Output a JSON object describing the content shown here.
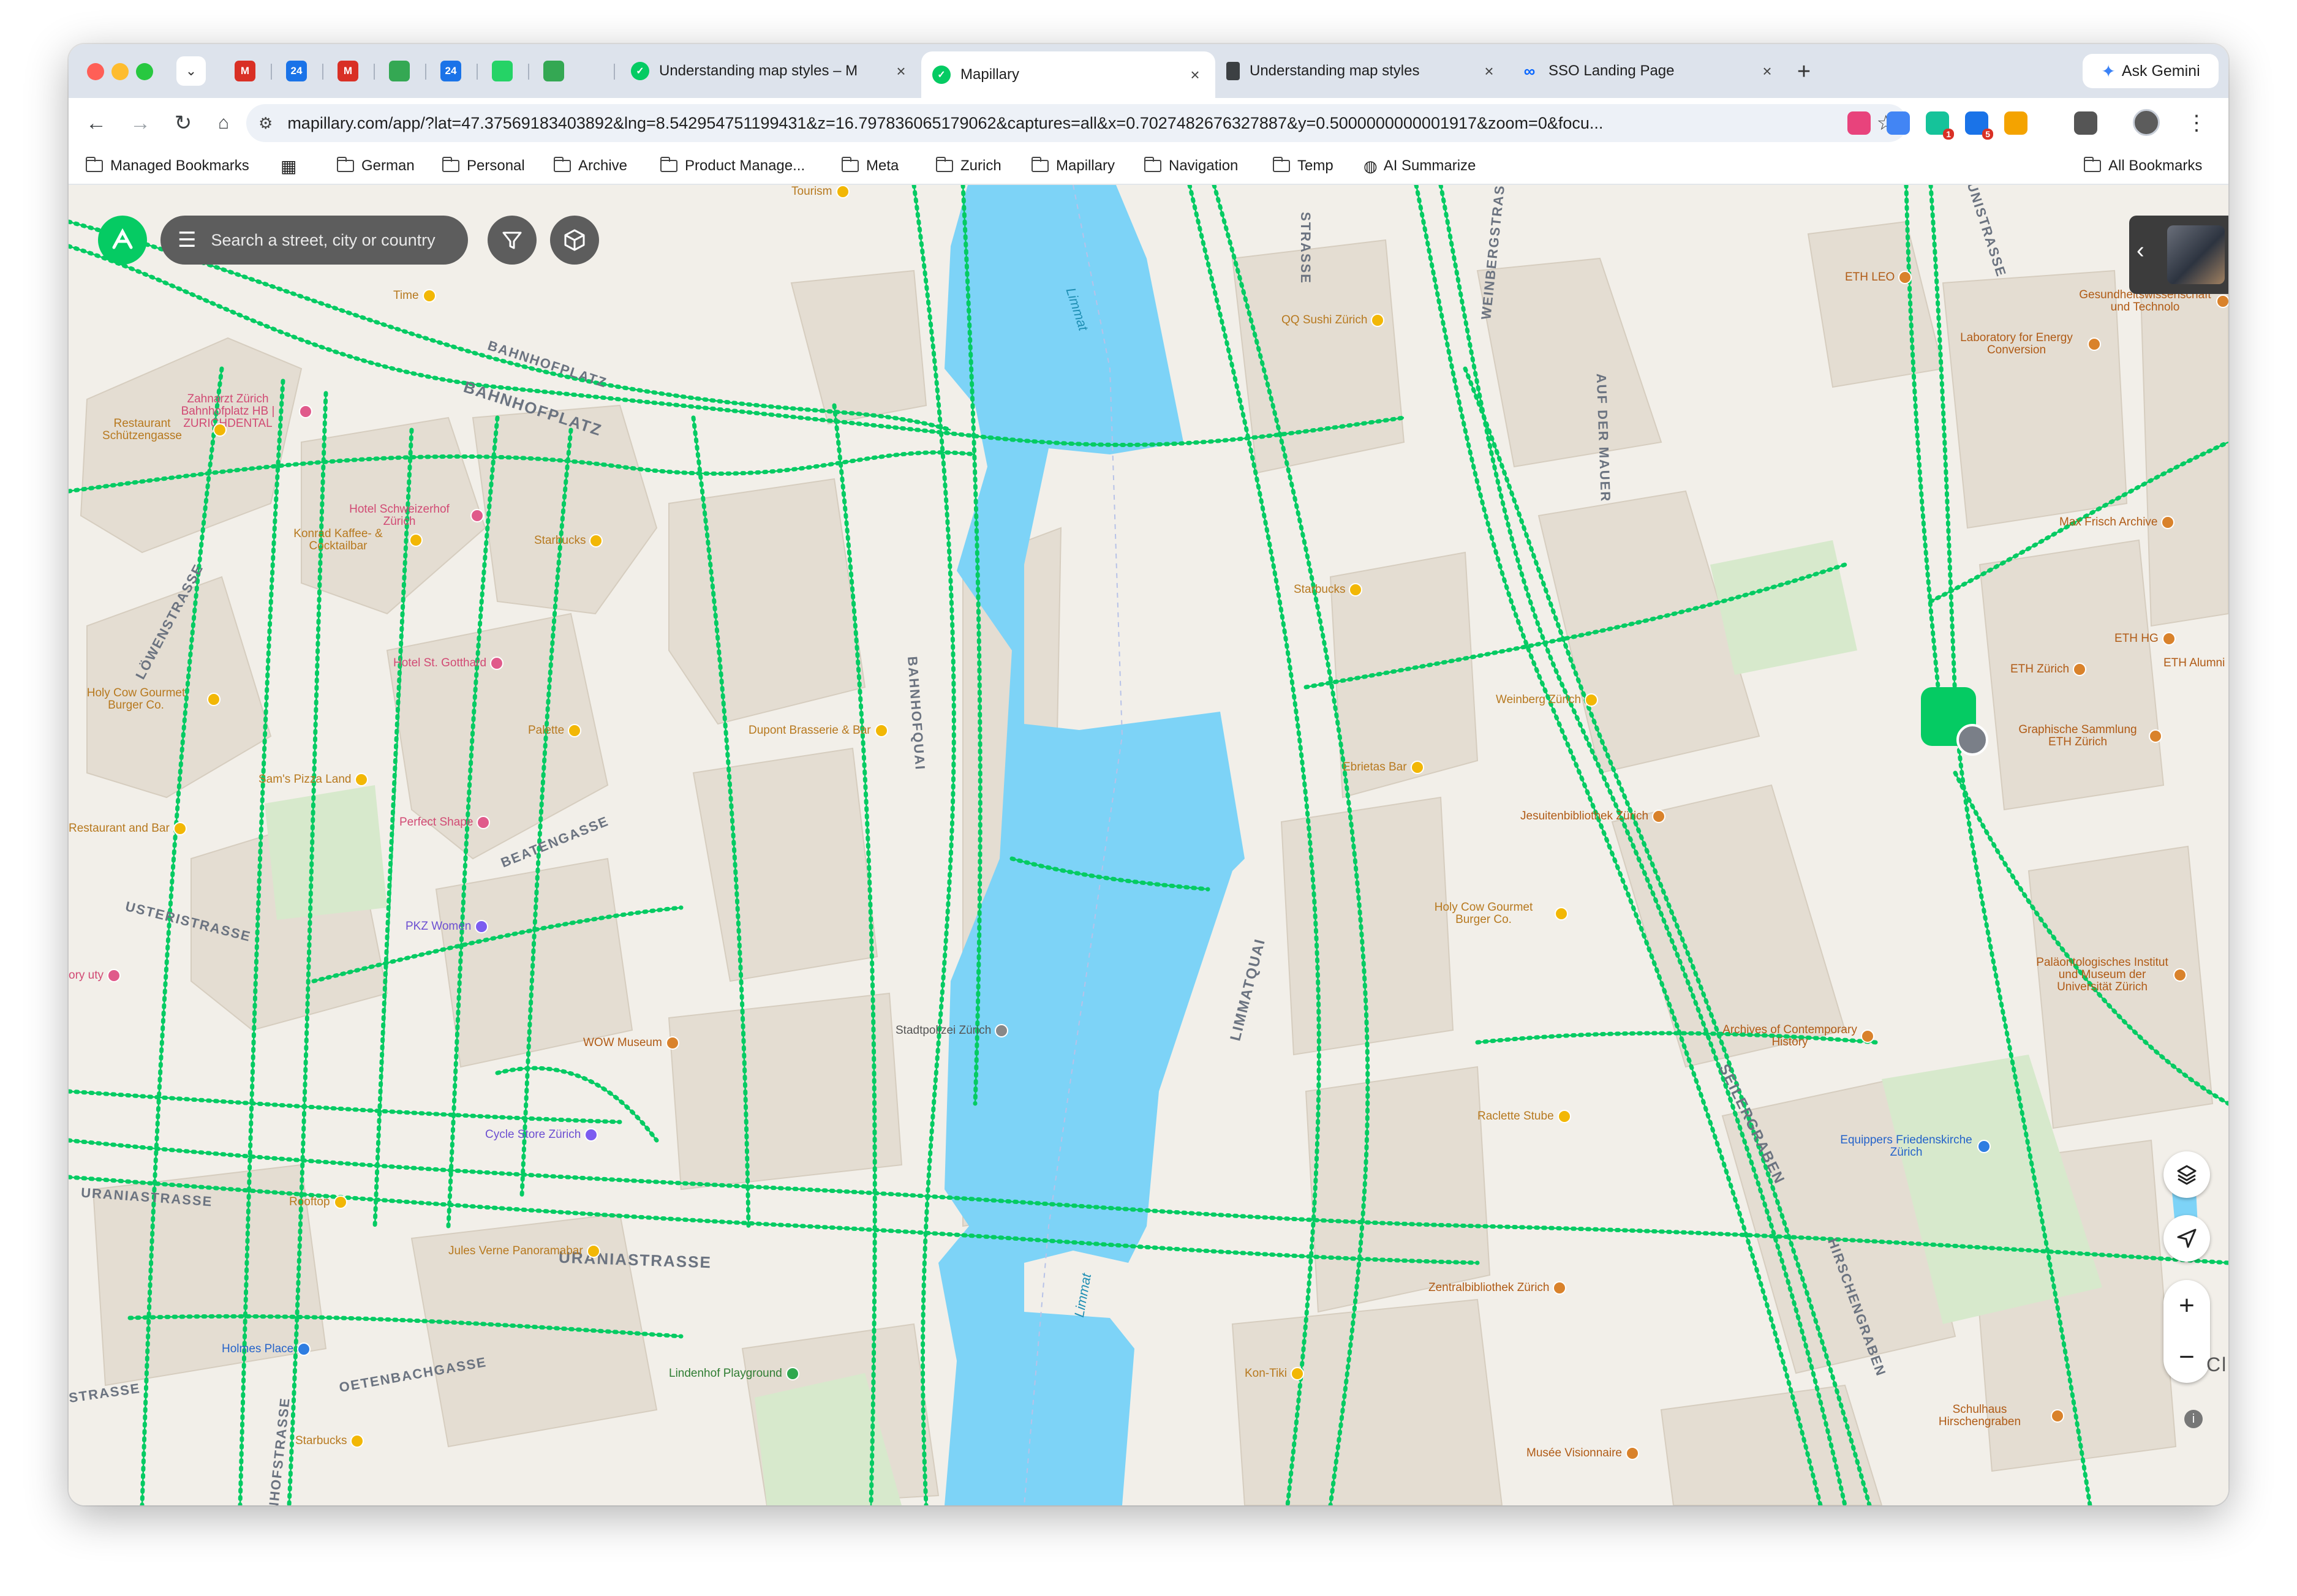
{
  "browser": {
    "pinned_tabs": [
      {
        "icon": "gmail-icon",
        "label": "M",
        "color": "#d93025"
      },
      {
        "icon": "calendar-icon",
        "label": "24",
        "color": "#1a73e8"
      },
      {
        "icon": "gmail-icon",
        "label": "M",
        "color": "#d93025"
      },
      {
        "icon": "chat-icon",
        "label": "",
        "color": "#34a853"
      },
      {
        "icon": "calendar-icon",
        "label": "24",
        "color": "#1a73e8"
      },
      {
        "icon": "whatsapp-icon",
        "label": "",
        "color": "#25d366"
      },
      {
        "icon": "phone-icon",
        "label": "",
        "color": "#34a853"
      }
    ],
    "tabs": [
      {
        "title": "Understanding map styles – M",
        "favicon": "mapillary-icon",
        "active": false
      },
      {
        "title": "Mapillary",
        "favicon": "mapillary-icon",
        "active": true
      },
      {
        "title": "Understanding map styles",
        "favicon": "doc-icon",
        "active": false
      },
      {
        "title": "SSO Landing Page",
        "favicon": "meta-icon",
        "active": false
      }
    ],
    "ask_gemini": "Ask Gemini",
    "url": "mapillary.com/app/?lat=47.37569183403892&lng=8.542954751199431&z=16.797836065179062&captures=all&x=0.7027482676327887&y=0.5000000000001917&zoom=0&focu...",
    "extensions": [
      {
        "name": "translate-ext",
        "color": "#e8437c"
      },
      {
        "name": "google-translate-ext",
        "color": "#4285f4"
      },
      {
        "name": "grammarly-ext",
        "color": "#15c39a",
        "badge": "1"
      },
      {
        "name": "notes-ext",
        "color": "#1a73e8",
        "badge": "5"
      },
      {
        "name": "color-picker-ext",
        "color": "#f4a300"
      },
      {
        "name": "puzzle-icon",
        "color": "#555555"
      }
    ]
  },
  "bookmarks": {
    "managed": "Managed Bookmarks",
    "items": [
      "German",
      "Personal",
      "Archive",
      "Product Manage...",
      "Meta",
      "Zurich",
      "Mapillary",
      "Navigation",
      "Temp"
    ],
    "ai": "AI Summarize",
    "all": "All Bookmarks"
  },
  "map": {
    "search_placeholder": "Search a street, city or country",
    "coverage_color": "#05cb63",
    "water_color": "#7dd3f7",
    "streets": [
      {
        "name": "BAHNHOFPLATZ"
      },
      {
        "name": "BAHNHOFPLATZ"
      },
      {
        "name": "LÖWENSTRASSE"
      },
      {
        "name": "BAHNHOFQUAI"
      },
      {
        "name": "BEATENGASSE"
      },
      {
        "name": "USTERISTRASSE"
      },
      {
        "name": "URANIASTRASSE"
      },
      {
        "name": "URANIASTRASSE"
      },
      {
        "name": "OETENBACHGASSE"
      },
      {
        "name": "LIMMATQUAI"
      },
      {
        "name": "SEILERGRABEN"
      },
      {
        "name": "HIRSCHENGRABEN"
      },
      {
        "name": "AUF DER MAUER"
      },
      {
        "name": "WEINBERGSTRASSE"
      },
      {
        "name": "STRASSE"
      },
      {
        "name": "UNISTRASSE"
      },
      {
        "name": "STRASSE"
      },
      {
        "name": "NHOFSTRASSE"
      }
    ],
    "water_labels": [
      "Limmat",
      "Limmat"
    ],
    "pois": [
      {
        "name": "Tourism",
        "cls": "poi-food"
      },
      {
        "name": "Zahnarzt Zürich Bahnhofplatz HB | ZURICHDENTAL",
        "cls": "poi-hotel"
      },
      {
        "name": "Time",
        "cls": "poi-food"
      },
      {
        "name": "Restaurant Schützengasse",
        "cls": "poi-food"
      },
      {
        "name": "Hotel Schweizerhof Zürich",
        "cls": "poi-hotel"
      },
      {
        "name": "Konrad Kaffee- & Cocktailbar",
        "cls": "poi-food"
      },
      {
        "name": "Starbucks",
        "cls": "poi-food"
      },
      {
        "name": "Hotel St. Gotthard",
        "cls": "poi-hotel"
      },
      {
        "name": "Palette",
        "cls": "poi-food"
      },
      {
        "name": "Holy Cow Gourmet Burger Co.",
        "cls": "poi-food"
      },
      {
        "name": "Sam's Pizza Land",
        "cls": "poi-food"
      },
      {
        "name": "Restaurant and Bar",
        "cls": "poi-food"
      },
      {
        "name": "Perfect Shape",
        "cls": "poi-hotel"
      },
      {
        "name": "PKZ Women",
        "cls": "poi-shop"
      },
      {
        "name": "Dupont Brasserie & Bar",
        "cls": "poi-food"
      },
      {
        "name": "Stadtpolizei Zürich",
        "cls": "poi-gov"
      },
      {
        "name": "WOW Museum",
        "cls": "poi-edu"
      },
      {
        "name": "Cycle Store Zürich",
        "cls": "poi-shop"
      },
      {
        "name": "Rooftop",
        "cls": "poi-food"
      },
      {
        "name": "Jules Verne Panoramabar",
        "cls": "poi-food"
      },
      {
        "name": "Holmes Place",
        "cls": "poi-blue"
      },
      {
        "name": "Lindenhof Playground",
        "cls": "poi-green"
      },
      {
        "name": "Starbucks",
        "cls": "poi-food"
      },
      {
        "name": "QQ Sushi Zürich",
        "cls": "poi-food"
      },
      {
        "name": "Starbucks",
        "cls": "poi-food"
      },
      {
        "name": "Weinberg Zürich",
        "cls": "poi-food"
      },
      {
        "name": "Ebrietas Bar",
        "cls": "poi-food"
      },
      {
        "name": "Jesuitenbibliothek Zürich",
        "cls": "poi-edu"
      },
      {
        "name": "Holy Cow Gourmet Burger Co.",
        "cls": "poi-food"
      },
      {
        "name": "Raclette Stube",
        "cls": "poi-food"
      },
      {
        "name": "Zentralbibliothek Zürich",
        "cls": "poi-edu"
      },
      {
        "name": "Kon-Tiki",
        "cls": "poi-food"
      },
      {
        "name": "Musée Visionnaire",
        "cls": "poi-edu"
      },
      {
        "name": "Archives of Contemporary History",
        "cls": "poi-edu"
      },
      {
        "name": "Equippers Friedenskirche Zürich",
        "cls": "poi-blue"
      },
      {
        "name": "Schulhaus Hirschengraben",
        "cls": "poi-edu"
      },
      {
        "name": "ETH LEO",
        "cls": "poi-edu"
      },
      {
        "name": "Gesundheitswissenschaft und Technolo",
        "cls": "poi-edu"
      },
      {
        "name": "Laboratory for Energy Conversion",
        "cls": "poi-edu"
      },
      {
        "name": "Max Frisch Archive",
        "cls": "poi-edu"
      },
      {
        "name": "ETH HG",
        "cls": "poi-edu"
      },
      {
        "name": "ETH Zürich",
        "cls": "poi-edu"
      },
      {
        "name": "ETH Alumni",
        "cls": "poi-edu"
      },
      {
        "name": "Graphische Sammlung ETH Zürich",
        "cls": "poi-edu"
      },
      {
        "name": "Paläontologisches Institut und Museum der Universität Zürich",
        "cls": "poi-edu"
      },
      {
        "name": "ory uty",
        "cls": "poi-hotel"
      }
    ],
    "edge_text": "Cl"
  }
}
